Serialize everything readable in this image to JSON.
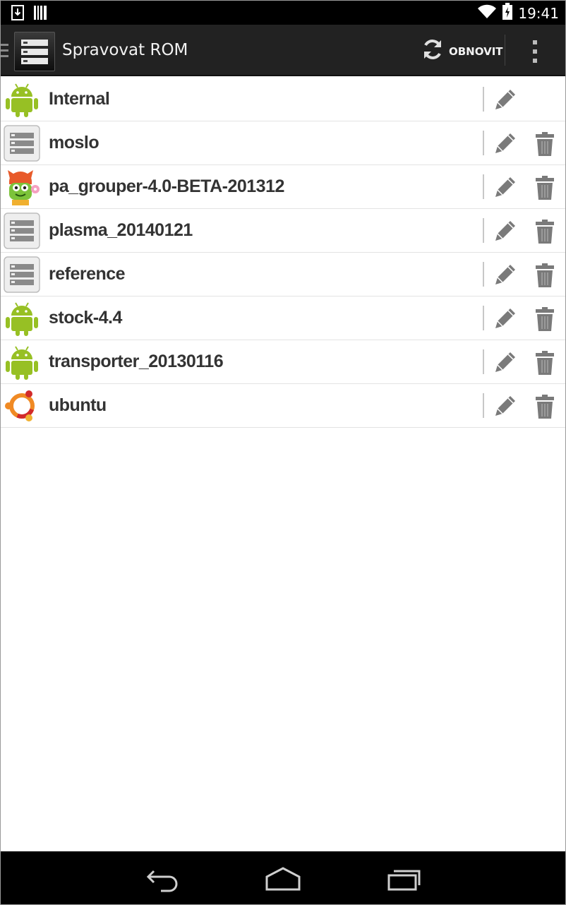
{
  "status_bar": {
    "time": "19:41",
    "left_icons": [
      "download-notification-icon",
      "barcode-notification-icon"
    ],
    "right_icons": [
      "wifi-icon",
      "battery-charging-icon"
    ]
  },
  "action_bar": {
    "title": "Spravovat ROM",
    "refresh_label": "OBNOVIT",
    "background": "#222222"
  },
  "roms": [
    {
      "name": "Internal",
      "icon": "android-icon",
      "can_delete": false
    },
    {
      "name": "moslo",
      "icon": "rom-storage-icon",
      "can_delete": true
    },
    {
      "name": "pa_grouper-4.0-BETA-201312",
      "icon": "paranoid-android-icon",
      "can_delete": true
    },
    {
      "name": "plasma_20140121",
      "icon": "rom-storage-icon",
      "can_delete": true
    },
    {
      "name": "reference",
      "icon": "rom-storage-icon",
      "can_delete": true
    },
    {
      "name": "stock-4.4",
      "icon": "android-icon",
      "can_delete": true
    },
    {
      "name": "transporter_20130116",
      "icon": "android-icon",
      "can_delete": true
    },
    {
      "name": "ubuntu",
      "icon": "ubuntu-icon",
      "can_delete": true
    }
  ],
  "nav_bar": {
    "buttons": [
      "back-icon",
      "home-icon",
      "recents-icon"
    ]
  },
  "colors": {
    "android_green": "#97c024",
    "action_icon_gray": "#7a7a7a",
    "ubuntu_orange": "#f08a24",
    "ubuntu_red": "#d22a2a"
  }
}
